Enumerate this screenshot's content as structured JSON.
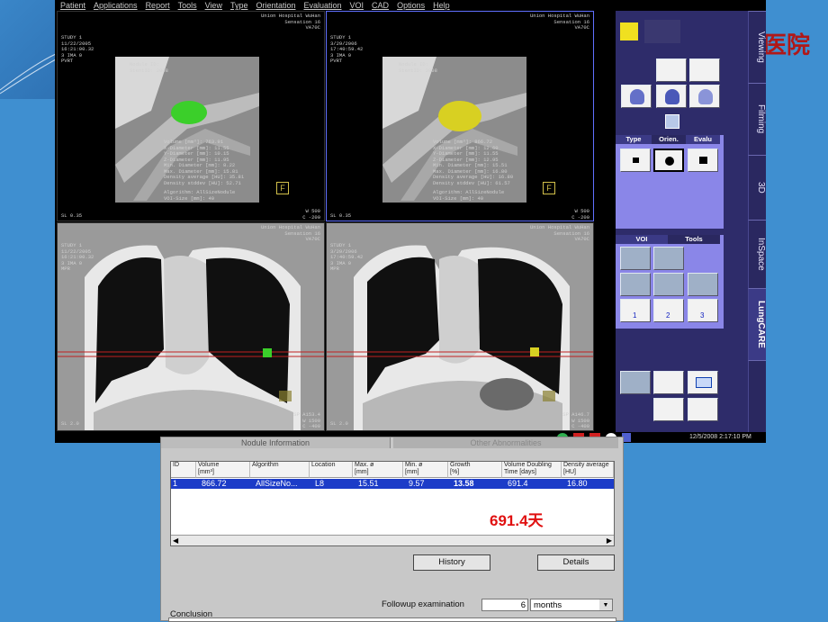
{
  "menubar": [
    "Patient",
    "Applications",
    "Report",
    "Tools",
    "View",
    "Type",
    "Orientation",
    "Evaluation",
    "VOI",
    "CAD",
    "Options",
    "Help"
  ],
  "viewports": [
    {
      "hospital": "Union Hospital WuHan",
      "scanner": "Sensation 16",
      "version": "VA70C",
      "study": "STUDY 1",
      "date": "11/22/2005",
      "time": "16:21:00.32",
      "ima": "3 IMA 0",
      "mode": "PVRT",
      "nodule": "Nodule ID:",
      "stent": "StentID: 2008",
      "measures": "Volume [mm³]: 763.91\nX-Diameter [mm]: 11.55\nY-Diameter [mm]: 10.15\nZ-Diameter [mm]: 11.95\nMin. Diameter [mm]: 8.22\nMax. Diameter [mm]: 15.81\nDensity average [HU]: 35.81\nDensity stddev [HU]: 52.71",
      "algorithm": "Algorithm: AllSizeNodule\nVOI-Size [mm]: 40",
      "sl": "SL 0.35",
      "wc": "W 500\nC -200",
      "f": "F"
    },
    {
      "hospital": "Union Hospital WuHan",
      "scanner": "Sensation 16",
      "version": "VA70C",
      "study": "STUDY 1",
      "date": "3/29/2006",
      "time": "17:40:59.42",
      "ima": "3 IMA 0",
      "mode": "PVRT",
      "nodule": "Nodule ID:",
      "stent": "StentID: 2008",
      "measures": "Volume [mm³]: 866.72\nX-Diameter [mm]: 12.60\nY-Diameter [mm]: 11.55\nZ-Diameter [mm]: 12.95\nMin. Diameter [mm]: 15.51\nMax. Diameter [mm]: 16.80\nDensity average [HU]: 16.80\nDensity stddev [HU]: 61.57",
      "algorithm": "Algorithm: AllSizeNodule\nVOI-Size [mm]: 40",
      "sl": "SL 0.35",
      "wc": "W 500\nC -200",
      "f": "F"
    },
    {
      "hospital": "Union Hospital WuHan",
      "scanner": "Sensation 16",
      "version": "VA70C",
      "study": "STUDY 1",
      "date": "11/22/2005",
      "time": "16:21:00.32",
      "ima": "3 IMA 0",
      "mode": "MPR",
      "sl": "SL 2.0",
      "right": "SP A153.4\nW 1500\nC -400"
    },
    {
      "hospital": "Union Hospital WuHan",
      "scanner": "Sensation 16",
      "version": "VA70C",
      "study": "STUDY 1",
      "date": "3/29/2006",
      "time": "17:40:59.42",
      "ima": "3 IMA 0",
      "mode": "MPR",
      "sl": "SL 2.0",
      "right": "SP A146.7\nW 1500\nC -400"
    }
  ],
  "side": {
    "tabs": [
      "Viewing",
      "Filming",
      "3D",
      "InSpace",
      "LungCARE"
    ],
    "type_panel": {
      "type": "Type",
      "orien": "Orien.",
      "evalu": "Evalu"
    },
    "tools_panel": {
      "voi": "VOI",
      "tools": "Tools",
      "n1": "1",
      "n2": "2",
      "n3": "3"
    }
  },
  "statusbar": {
    "datetime": "12/5/2008 2:17:10 PM"
  },
  "dialog": {
    "tab1": "Nodule Information",
    "tab2": "Other Abnormalities",
    "headers": [
      "ID",
      "Volume\n[mm³]",
      "Algorithm",
      "Location",
      "Max. ø\n[mm]",
      "Min. ø\n[mm]",
      "Growth\n[%]",
      "Volume Doubling\nTime [days]",
      "Density average\n[HU]"
    ],
    "row": [
      "1",
      "866.72",
      "AllSizeNo...",
      "L8",
      "15.51",
      "9.57",
      "13.58",
      "691.4",
      "16.80"
    ],
    "callout": "691.4天",
    "history": "History",
    "details": "Details",
    "followup_label": "Followup examination",
    "followup_value": "6",
    "followup_unit": "months",
    "conclusion": "Conclusion"
  },
  "colors": {
    "background": "#3f8fd0",
    "side_panel": "#2e2c6a",
    "panel": "#8a86e8",
    "selected_row": "#1c3cc8",
    "callout": "#e01010",
    "nodule_green": "#3bcf2a",
    "nodule_yellow": "#d8d022"
  },
  "logo": "医院"
}
